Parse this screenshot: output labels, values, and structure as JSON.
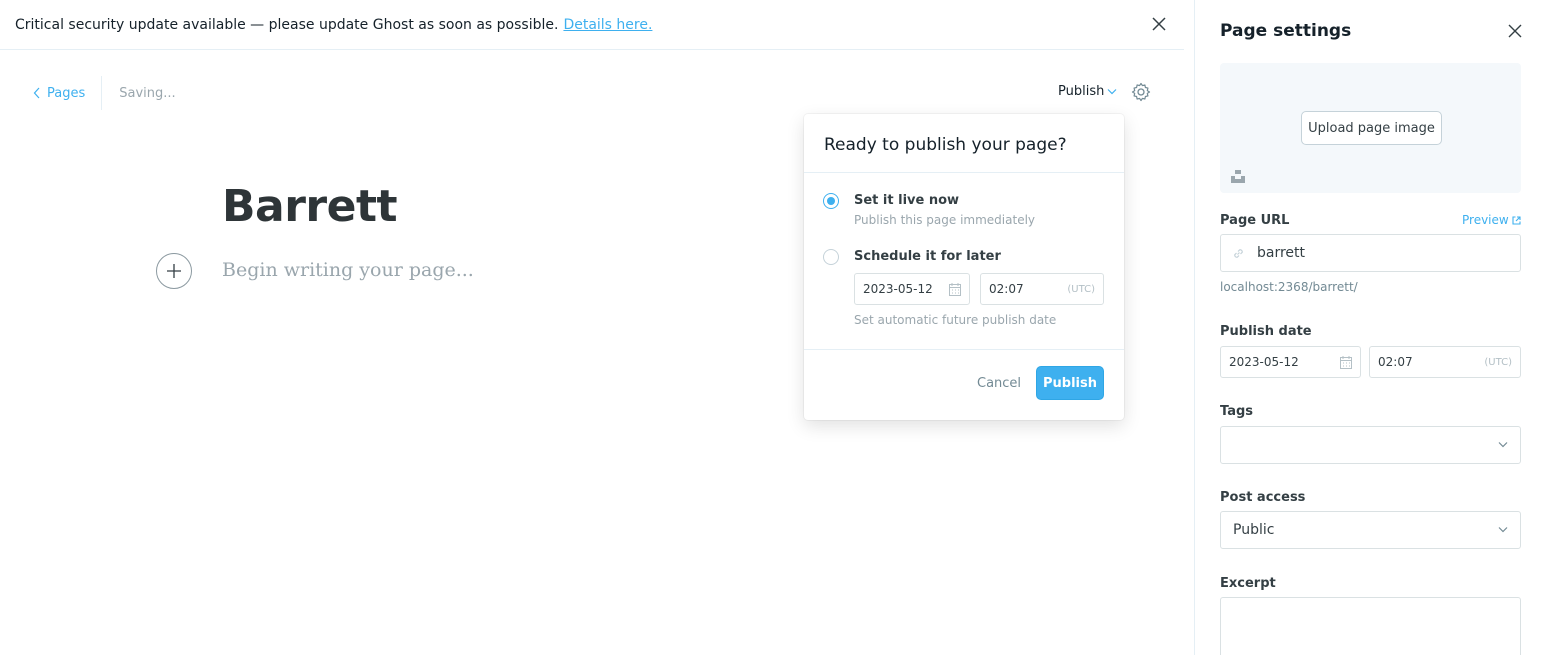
{
  "alert": {
    "message": "Critical security update available — please update Ghost as soon as possible.",
    "link_text": "Details here."
  },
  "editor_nav": {
    "back_label": "Pages",
    "status": "Saving...",
    "publish_menu_label": "Publish"
  },
  "editor": {
    "title": "Barrett",
    "body_placeholder": "Begin writing your page..."
  },
  "publish_popup": {
    "heading": "Ready to publish your page?",
    "option_now": {
      "title": "Set it live now",
      "description": "Publish this page immediately",
      "selected": true
    },
    "option_later": {
      "title": "Schedule it for later",
      "date": "2023-05-12",
      "time": "02:07",
      "timezone": "(UTC)",
      "description": "Set automatic future publish date",
      "selected": false
    },
    "cancel_label": "Cancel",
    "publish_label": "Publish"
  },
  "settings_panel": {
    "title": "Page settings",
    "upload_label": "Upload page image",
    "url_label": "Page URL",
    "preview_label": "Preview",
    "slug": "barrett",
    "url_hint": "localhost:2368/barrett/",
    "publish_date_label": "Publish date",
    "publish_date": "2023-05-12",
    "publish_time": "02:07",
    "timezone": "(UTC)",
    "tags_label": "Tags",
    "access_label": "Post access",
    "access_value": "Public",
    "excerpt_label": "Excerpt"
  },
  "colors": {
    "accent": "#3eb0ef",
    "text": "#15212a",
    "muted": "#9aa6ad",
    "border": "#dae1e3"
  },
  "icons": [
    "close-icon",
    "chevron-left-icon",
    "chevron-down-icon",
    "gear-icon",
    "plus-icon",
    "calendar-icon",
    "link-icon",
    "external-link-icon",
    "unsplash-icon"
  ]
}
